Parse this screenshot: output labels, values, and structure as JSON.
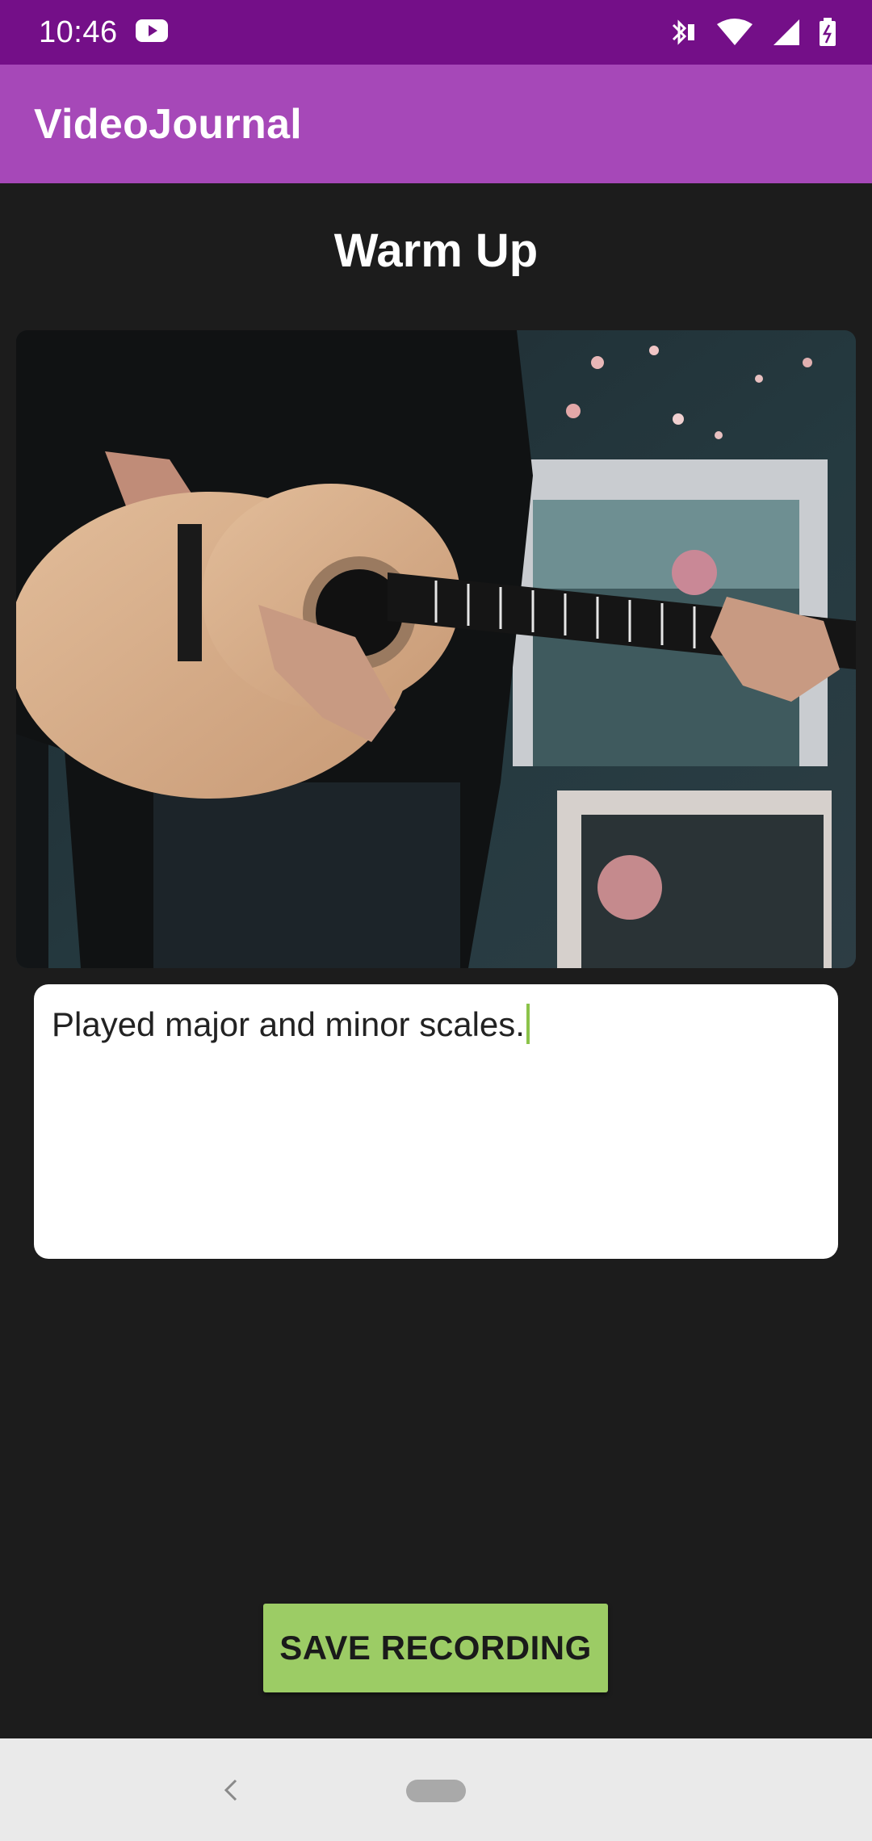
{
  "status_bar": {
    "time": "10:46",
    "icons": [
      "youtube-icon",
      "bluetooth-icon",
      "wifi-icon",
      "signal-icon",
      "battery-icon"
    ]
  },
  "app_bar": {
    "title": "VideoJournal"
  },
  "entry": {
    "title": "Warm Up",
    "notes": "Played major and minor scales."
  },
  "video": {
    "icon": "video-thumbnail"
  },
  "actions": {
    "save_label": "SAVE RECORDING"
  },
  "navigation": {
    "icons": [
      "back-icon",
      "home-pill-icon"
    ]
  },
  "colors": {
    "status_bar": "#740f88",
    "app_bar": "#a648b8",
    "background": "#1c1c1c",
    "accent": "#9ccc65"
  }
}
